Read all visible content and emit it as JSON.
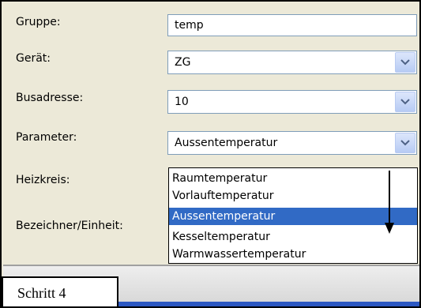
{
  "form": {
    "labels": {
      "gruppe": "Gruppe:",
      "geraet": "Gerät:",
      "busadresse": "Busadresse:",
      "parameter": "Parameter:",
      "heizkreis": "Heizkreis:",
      "bezeichner": "Bezeichner/Einheit:"
    },
    "gruppe_value": "temp",
    "geraet_value": "ZG",
    "busadresse_value": "10",
    "parameter_value": "Aussentemperatur"
  },
  "dropdown": {
    "options": [
      "Raumtemperatur",
      "Vorlauftemperatur",
      "Aussentemperatur",
      "Kesseltemperatur",
      "Warmwassertemperatur"
    ],
    "selected_index": 2
  },
  "step_label": "Schritt 4",
  "colors": {
    "selection": "#316ac5",
    "background": "#ece9d8",
    "border": "#7f9db9"
  }
}
